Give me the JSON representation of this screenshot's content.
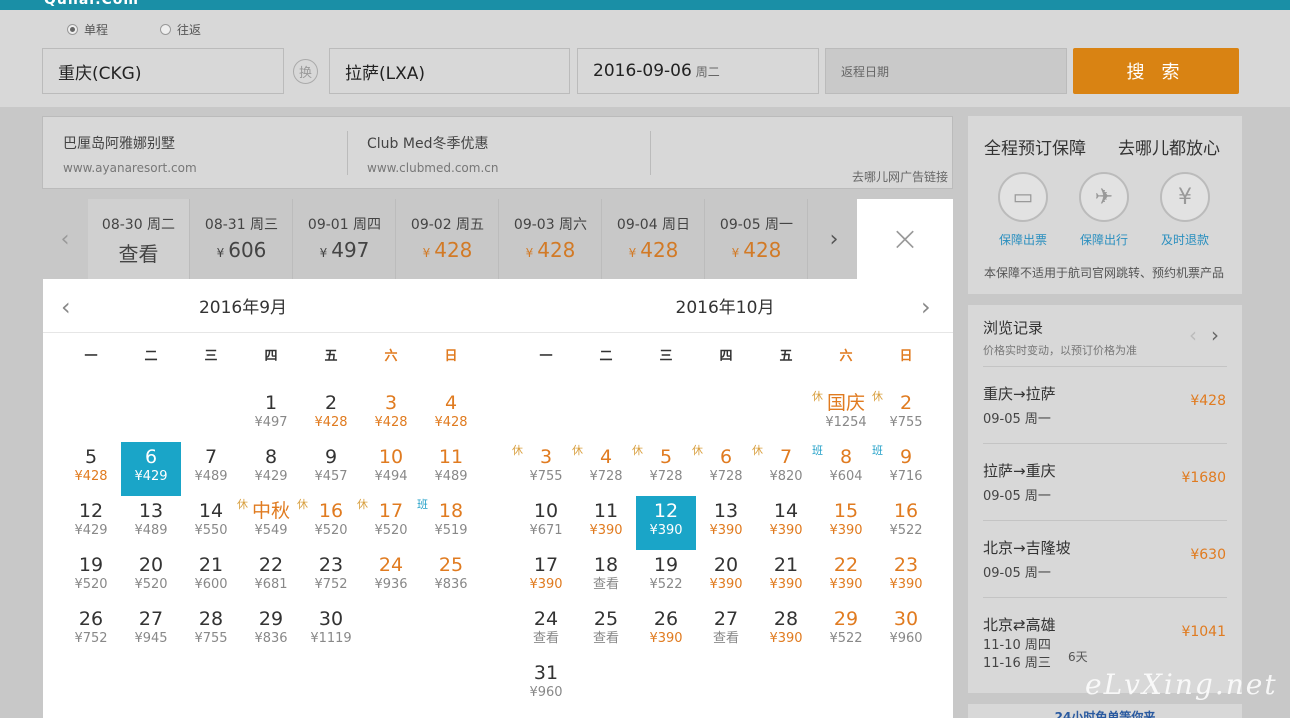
{
  "header": {
    "logo": "Qunar.Com"
  },
  "trip_type": {
    "oneway": "单程",
    "roundtrip": "往返",
    "selected": "oneway"
  },
  "search": {
    "from": "重庆(CKG)",
    "swap": "换",
    "to": "拉萨(LXA)",
    "depart_date": "2016-09-06",
    "depart_weekday": "周二",
    "return_placeholder": "返程日期",
    "button": "搜 索"
  },
  "ads": {
    "items": [
      {
        "title": "巴厘岛阿雅娜别墅",
        "url": "www.ayanaresort.com"
      },
      {
        "title": "Club Med冬季优惠",
        "url": "www.clubmed.com.cn"
      }
    ],
    "label": "去哪儿网广告链接"
  },
  "date_strip": {
    "prev": "‹",
    "next": "›",
    "cells": [
      {
        "date": "08-30 周二",
        "price": "查看",
        "currency": "",
        "orange": false
      },
      {
        "date": "08-31 周三",
        "price": "606",
        "currency": "¥",
        "orange": false
      },
      {
        "date": "09-01 周四",
        "price": "497",
        "currency": "¥",
        "orange": false
      },
      {
        "date": "09-02 周五",
        "price": "428",
        "currency": "¥",
        "orange": true
      },
      {
        "date": "09-03 周六",
        "price": "428",
        "currency": "¥",
        "orange": true
      },
      {
        "date": "09-04 周日",
        "price": "428",
        "currency": "¥",
        "orange": true
      },
      {
        "date": "09-05 周一",
        "price": "428",
        "currency": "¥",
        "orange": true
      }
    ],
    "close": "×"
  },
  "calendar": {
    "prev": "‹",
    "next": "›",
    "weekdays": [
      "一",
      "二",
      "三",
      "四",
      "五",
      "六",
      "日"
    ],
    "months": [
      {
        "title": "2016年9月",
        "days": [
          {
            "col": 3,
            "row": 0,
            "n": "1",
            "p": "¥497"
          },
          {
            "col": 4,
            "row": 0,
            "n": "2",
            "p": "¥428",
            "o": true
          },
          {
            "col": 5,
            "row": 0,
            "n": "3",
            "p": "¥428",
            "o": true
          },
          {
            "col": 6,
            "row": 0,
            "n": "4",
            "p": "¥428",
            "o": true
          },
          {
            "col": 0,
            "row": 1,
            "n": "5",
            "p": "¥428",
            "o": true
          },
          {
            "col": 1,
            "row": 1,
            "n": "6",
            "p": "¥429",
            "sel": true
          },
          {
            "col": 2,
            "row": 1,
            "n": "7",
            "p": "¥489"
          },
          {
            "col": 3,
            "row": 1,
            "n": "8",
            "p": "¥429"
          },
          {
            "col": 4,
            "row": 1,
            "n": "9",
            "p": "¥457"
          },
          {
            "col": 5,
            "row": 1,
            "n": "10",
            "p": "¥494"
          },
          {
            "col": 6,
            "row": 1,
            "n": "11",
            "p": "¥489"
          },
          {
            "col": 0,
            "row": 2,
            "n": "12",
            "p": "¥429"
          },
          {
            "col": 1,
            "row": 2,
            "n": "13",
            "p": "¥489"
          },
          {
            "col": 2,
            "row": 2,
            "n": "14",
            "p": "¥550"
          },
          {
            "col": 3,
            "row": 2,
            "n": "中秋",
            "p": "¥549",
            "tag": "休",
            "hol": true
          },
          {
            "col": 4,
            "row": 2,
            "n": "16",
            "p": "¥520",
            "tag": "休",
            "hol": true
          },
          {
            "col": 5,
            "row": 2,
            "n": "17",
            "p": "¥520",
            "tag": "休"
          },
          {
            "col": 6,
            "row": 2,
            "n": "18",
            "p": "¥519",
            "tag": "班"
          },
          {
            "col": 0,
            "row": 3,
            "n": "19",
            "p": "¥520"
          },
          {
            "col": 1,
            "row": 3,
            "n": "20",
            "p": "¥520"
          },
          {
            "col": 2,
            "row": 3,
            "n": "21",
            "p": "¥600"
          },
          {
            "col": 3,
            "row": 3,
            "n": "22",
            "p": "¥681"
          },
          {
            "col": 4,
            "row": 3,
            "n": "23",
            "p": "¥752"
          },
          {
            "col": 5,
            "row": 3,
            "n": "24",
            "p": "¥936"
          },
          {
            "col": 6,
            "row": 3,
            "n": "25",
            "p": "¥836"
          },
          {
            "col": 0,
            "row": 4,
            "n": "26",
            "p": "¥752"
          },
          {
            "col": 1,
            "row": 4,
            "n": "27",
            "p": "¥945"
          },
          {
            "col": 2,
            "row": 4,
            "n": "28",
            "p": "¥755"
          },
          {
            "col": 3,
            "row": 4,
            "n": "29",
            "p": "¥836"
          },
          {
            "col": 4,
            "row": 4,
            "n": "30",
            "p": "¥1119"
          }
        ]
      },
      {
        "title": "2016年10月",
        "days": [
          {
            "col": 5,
            "row": 0,
            "n": "国庆",
            "p": "¥1254",
            "tag": "休",
            "hol": true
          },
          {
            "col": 6,
            "row": 0,
            "n": "2",
            "p": "¥755",
            "tag": "休"
          },
          {
            "col": 0,
            "row": 1,
            "n": "3",
            "p": "¥755",
            "tag": "休",
            "hol": true
          },
          {
            "col": 1,
            "row": 1,
            "n": "4",
            "p": "¥728",
            "tag": "休",
            "hol": true
          },
          {
            "col": 2,
            "row": 1,
            "n": "5",
            "p": "¥728",
            "tag": "休",
            "hol": true
          },
          {
            "col": 3,
            "row": 1,
            "n": "6",
            "p": "¥728",
            "tag": "休",
            "hol": true
          },
          {
            "col": 4,
            "row": 1,
            "n": "7",
            "p": "¥820",
            "tag": "休",
            "hol": true
          },
          {
            "col": 5,
            "row": 1,
            "n": "8",
            "p": "¥604",
            "tag": "班"
          },
          {
            "col": 6,
            "row": 1,
            "n": "9",
            "p": "¥716",
            "tag": "班"
          },
          {
            "col": 0,
            "row": 2,
            "n": "10",
            "p": "¥671"
          },
          {
            "col": 1,
            "row": 2,
            "n": "11",
            "p": "¥390",
            "o": true
          },
          {
            "col": 2,
            "row": 2,
            "n": "12",
            "p": "¥390",
            "sel": true
          },
          {
            "col": 3,
            "row": 2,
            "n": "13",
            "p": "¥390",
            "o": true
          },
          {
            "col": 4,
            "row": 2,
            "n": "14",
            "p": "¥390",
            "o": true
          },
          {
            "col": 5,
            "row": 2,
            "n": "15",
            "p": "¥390",
            "o": true
          },
          {
            "col": 6,
            "row": 2,
            "n": "16",
            "p": "¥522"
          },
          {
            "col": 0,
            "row": 3,
            "n": "17",
            "p": "¥390",
            "o": true
          },
          {
            "col": 1,
            "row": 3,
            "n": "18",
            "p": "查看"
          },
          {
            "col": 2,
            "row": 3,
            "n": "19",
            "p": "¥522"
          },
          {
            "col": 3,
            "row": 3,
            "n": "20",
            "p": "¥390",
            "o": true
          },
          {
            "col": 4,
            "row": 3,
            "n": "21",
            "p": "¥390",
            "o": true
          },
          {
            "col": 5,
            "row": 3,
            "n": "22",
            "p": "¥390",
            "o": true
          },
          {
            "col": 6,
            "row": 3,
            "n": "23",
            "p": "¥390",
            "o": true
          },
          {
            "col": 0,
            "row": 4,
            "n": "24",
            "p": "查看"
          },
          {
            "col": 1,
            "row": 4,
            "n": "25",
            "p": "查看"
          },
          {
            "col": 2,
            "row": 4,
            "n": "26",
            "p": "¥390",
            "o": true
          },
          {
            "col": 3,
            "row": 4,
            "n": "27",
            "p": "查看"
          },
          {
            "col": 4,
            "row": 4,
            "n": "28",
            "p": "¥390",
            "o": true
          },
          {
            "col": 5,
            "row": 4,
            "n": "29",
            "p": "¥522"
          },
          {
            "col": 6,
            "row": 4,
            "n": "30",
            "p": "¥960"
          },
          {
            "col": 0,
            "row": 5,
            "n": "31",
            "p": "¥960"
          }
        ]
      }
    ]
  },
  "guarantee": {
    "title_left": "全程预订保障",
    "title_right": "去哪儿都放心",
    "items": [
      {
        "icon": "ticket-icon",
        "glyph": "▭",
        "label": "保障出票"
      },
      {
        "icon": "plane-icon",
        "glyph": "✈",
        "label": "保障出行"
      },
      {
        "icon": "yen-icon",
        "glyph": "¥",
        "label": "及时退款"
      }
    ],
    "note": "本保障不适用于航司官网跳转、预约机票产品"
  },
  "history": {
    "title": "浏览记录",
    "subtitle": "价格实时变动，以预订价格为准",
    "prev": "‹",
    "next": "›",
    "records": [
      {
        "route": "重庆→拉萨",
        "date": "09-05 周一",
        "price": "¥428"
      },
      {
        "route": "拉萨→重庆",
        "date": "09-05 周一",
        "price": "¥1680"
      },
      {
        "route": "北京→吉隆坡",
        "date": "09-05 周一",
        "price": "¥630"
      },
      {
        "route": "北京⇄高雄",
        "date": "11-10 周四",
        "date2": "11-16 周三",
        "days": "6天",
        "price": "¥1041"
      }
    ]
  },
  "service": {
    "text": "24小时免单等你来"
  },
  "watermark": "eLvXing.net"
}
